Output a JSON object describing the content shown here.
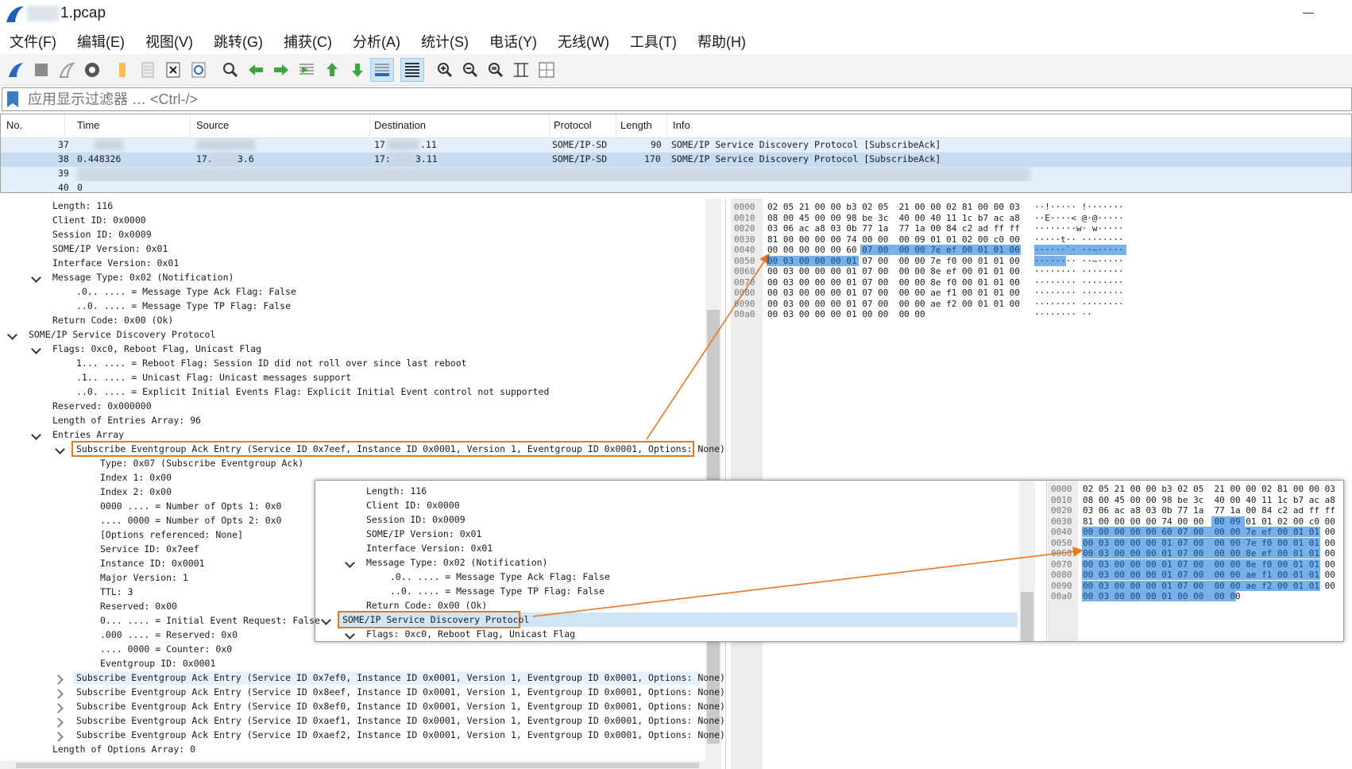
{
  "window": {
    "title": "1.pcap"
  },
  "menu": [
    "文件(F)",
    "编辑(E)",
    "视图(V)",
    "跳转(G)",
    "捕获(C)",
    "分析(A)",
    "统计(S)",
    "电话(Y)",
    "无线(W)",
    "工具(T)",
    "帮助(H)"
  ],
  "toolbar": [
    "shark-fin-start-icon",
    "stop-square-icon",
    "restart-fin-icon",
    "options-gear-icon",
    "open-folder-icon",
    "file-icon",
    "close-file-icon",
    "reload-icon",
    "find-icon",
    "back-arrow-icon",
    "forward-arrow-icon",
    "goto-packet-icon",
    "first-packet-icon",
    "last-packet-icon",
    "auto-scroll-icon",
    "colorize-icon",
    "zoom-in-icon",
    "zoom-out-icon",
    "zoom-normal-icon",
    "resize-columns-icon",
    "layout-icon"
  ],
  "filter": {
    "placeholder": "应用显示过滤器 … <Ctrl-/>"
  },
  "packet_list": {
    "columns": [
      "No.",
      "Time",
      "Source",
      "Destination",
      "Protocol",
      "Length",
      "Info"
    ],
    "rows": [
      {
        "no": "37",
        "time": "",
        "source": "",
        "dest_a": "17",
        "dest_b": ".11",
        "protocol": "SOME/IP-SD",
        "length": "90",
        "info": "SOME/IP Service Discovery Protocol [SubscribeAck]"
      },
      {
        "no": "38",
        "time": "0.448326",
        "source_a": "17.",
        "source_b": "3.6",
        "dest_a": "17:",
        "dest_b": "3.11",
        "protocol": "SOME/IP-SD",
        "length": "170",
        "info": "SOME/IP Service Discovery Protocol [SubscribeAck]"
      },
      {
        "no": "39"
      },
      {
        "no": "40",
        "time": "0"
      }
    ]
  },
  "details": [
    "Length: 116",
    "Client ID: 0x0000",
    "Session ID: 0x0009",
    "SOME/IP Version: 0x01",
    "Interface Version: 0x01",
    "Message Type: 0x02 (Notification)",
    ".0.. .... = Message Type Ack Flag: False",
    "..0. .... = Message Type TP Flag: False",
    "Return Code: 0x00 (Ok)",
    "SOME/IP Service Discovery Protocol",
    "Flags: 0xc0, Reboot Flag, Unicast Flag",
    "1... .... = Reboot Flag: Session ID did not roll over since last reboot",
    ".1.. .... = Unicast Flag: Unicast messages support",
    "..0. .... = Explicit Initial Events Flag: Explicit Initial Event control not supported",
    "Reserved: 0x000000",
    "Length of Entries Array: 96",
    "Entries Array",
    "Subscribe Eventgroup Ack Entry (Service ID 0x7eef, Instance ID 0x0001, Version 1, Eventgroup ID 0x0001, Options: None)",
    "Type: 0x07 (Subscribe Eventgroup Ack)",
    "Index 1: 0x00",
    "Index 2: 0x00",
    "0000 .... = Number of Opts 1: 0x0",
    ".... 0000 = Number of Opts 2: 0x0",
    "[Options referenced: None]",
    "Service ID: 0x7eef",
    "Instance ID: 0x0001",
    "Major Version: 1",
    "TTL: 3",
    "Reserved: 0x00",
    "0... .... = Initial Event Request: False",
    ".000 .... = Reserved: 0x0",
    ".... 0000 = Counter: 0x0",
    "Eventgroup ID: 0x0001",
    "Subscribe Eventgroup Ack Entry (Service ID 0x7ef0, Instance ID 0x0001, Version 1, Eventgroup ID 0x0001, Options: None)",
    "Subscribe Eventgroup Ack Entry (Service ID 0x8eef, Instance ID 0x0001, Version 1, Eventgroup ID 0x0001, Options: None)",
    "Subscribe Eventgroup Ack Entry (Service ID 0x8ef0, Instance ID 0x0001, Version 1, Eventgroup ID 0x0001, Options: None)",
    "Subscribe Eventgroup Ack Entry (Service ID 0xaef1, Instance ID 0x0001, Version 1, Eventgroup ID 0x0001, Options: None)",
    "Subscribe Eventgroup Ack Entry (Service ID 0xaef2, Instance ID 0x0001, Version 1, Eventgroup ID 0x0001, Options: None)",
    "Length of Options Array: 0"
  ],
  "bytes": {
    "offsets": [
      "0000",
      "0010",
      "0020",
      "0030",
      "0040",
      "0050",
      "0060",
      "0070",
      "0080",
      "0090",
      "00a0"
    ],
    "hex": [
      "02 05 21 00 00 b3 02 05  21 00 00 02 81 00 00 03",
      "08 00 45 00 00 98 be 3c  40 00 40 11 1c b7 ac a8",
      "03 06 ac a8 03 0b 77 1a  77 1a 00 84 c2 ad ff ff",
      "81 00 00 00 00 74 00 00  00 09 01 01 02 00 c0 00",
      "00 00 00 00 00 60 07 00  00 00 7e ef 00 01 01 00",
      "00 03 00 00 00 01 07 00  00 00 7e f0 00 01 01 00",
      "00 03 00 00 00 01 07 00  00 00 8e ef 00 01 01 00",
      "00 03 00 00 00 01 07 00  00 00 8e f0 00 01 01 00",
      "00 03 00 00 00 01 07 00  00 00 ae f1 00 01 01 00",
      "00 03 00 00 00 01 07 00  00 00 ae f2 00 01 01 00",
      "00 03 00 00 00 01 00 00  00 00"
    ],
    "ascii": [
      "··!····· !·······",
      "··E····< @·@·····",
      "········w· w·····",
      "·····t·· ········",
      "······`· ··~·····",
      "········ ··~·····",
      "········ ········",
      "········ ········",
      "········ ········",
      "········ ········",
      "········ ··"
    ]
  },
  "inset": {
    "details": [
      "Length: 116",
      "Client ID: 0x0000",
      "Session ID: 0x0009",
      "SOME/IP Version: 0x01",
      "Interface Version: 0x01",
      "Message Type: 0x02 (Notification)",
      ".0.. .... = Message Type Ack Flag: False",
      "..0. .... = Message Type TP Flag: False",
      "Return Code: 0x00 (Ok)",
      "SOME/IP Service Discovery Protocol",
      "Flags: 0xc0, Reboot Flag, Unicast Flag"
    ]
  },
  "colors": {
    "selection": "#0a6fd4",
    "highlight": "#e87722",
    "row_hover": "#e5f1fb"
  }
}
